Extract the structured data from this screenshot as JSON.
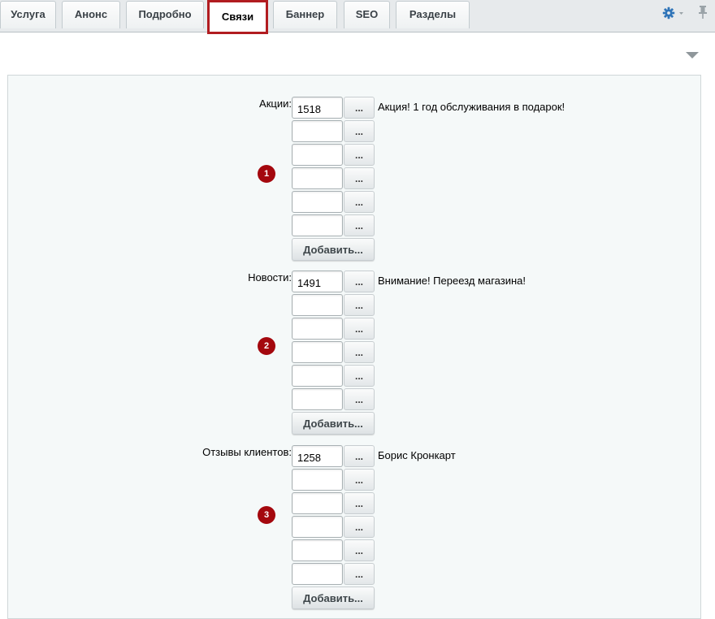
{
  "tabs": [
    {
      "label": "Услуга"
    },
    {
      "label": "Анонс"
    },
    {
      "label": "Подробно"
    },
    {
      "label": "Связи",
      "active": true
    },
    {
      "label": "Баннер"
    },
    {
      "label": "SEO"
    },
    {
      "label": "Разделы"
    }
  ],
  "toolbar": {
    "settings_icon": "gear-icon",
    "pin_icon": "pin-icon",
    "collapse_icon": "triangle-down-icon"
  },
  "picker_label": "...",
  "add_label": "Добавить...",
  "colors": {
    "active_tab_border": "#b11c20",
    "badge": "#a4080e",
    "gear": "#2f74b8"
  },
  "groups": [
    {
      "label": "Акции:",
      "badge": "1",
      "rows": [
        {
          "value": "1518",
          "name": "Акция! 1 год обслуживания в подарок!"
        },
        {
          "value": "",
          "name": ""
        },
        {
          "value": "",
          "name": ""
        },
        {
          "value": "",
          "name": ""
        },
        {
          "value": "",
          "name": ""
        },
        {
          "value": "",
          "name": ""
        }
      ]
    },
    {
      "label": "Новости:",
      "badge": "2",
      "rows": [
        {
          "value": "1491",
          "name": "Внимание! Переезд магазина!"
        },
        {
          "value": "",
          "name": ""
        },
        {
          "value": "",
          "name": ""
        },
        {
          "value": "",
          "name": ""
        },
        {
          "value": "",
          "name": ""
        },
        {
          "value": "",
          "name": ""
        }
      ]
    },
    {
      "label": "Отзывы клиентов:",
      "badge": "3",
      "rows": [
        {
          "value": "1258",
          "name": "Борис Кронкарт"
        },
        {
          "value": "",
          "name": ""
        },
        {
          "value": "",
          "name": ""
        },
        {
          "value": "",
          "name": ""
        },
        {
          "value": "",
          "name": ""
        },
        {
          "value": "",
          "name": ""
        }
      ]
    }
  ]
}
